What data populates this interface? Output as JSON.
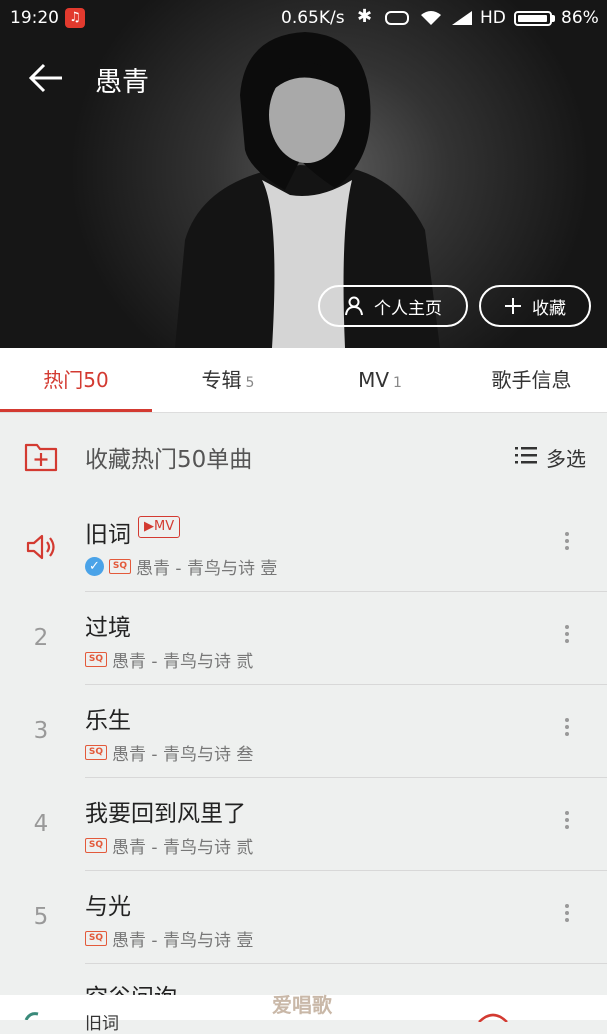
{
  "status_bar": {
    "time": "19:20",
    "app_icon": "netease-music-icon",
    "net_speed": "0.65K/s",
    "hd": "HD",
    "battery": "86%"
  },
  "header": {
    "artist_name": "愚青",
    "profile_button": "个人主页",
    "favorite_button": "收藏"
  },
  "tabs": [
    {
      "label": "热门50",
      "count": ""
    },
    {
      "label": "专辑",
      "count": "5"
    },
    {
      "label": "MV",
      "count": "1"
    },
    {
      "label": "歌手信息",
      "count": ""
    }
  ],
  "collect_bar": {
    "label": "收藏热门50单曲",
    "multi_select": "多选"
  },
  "songs": [
    {
      "num": "",
      "title": "旧词",
      "mv": "MV",
      "quality": "SQ",
      "meta": "愚青 - 青鸟与诗 壹",
      "playing": true
    },
    {
      "num": "2",
      "title": "过境",
      "quality": "SQ",
      "meta": "愚青 - 青鸟与诗 贰"
    },
    {
      "num": "3",
      "title": "乐生",
      "quality": "SQ",
      "meta": "愚青 - 青鸟与诗 叁"
    },
    {
      "num": "4",
      "title": "我要回到风里了",
      "quality": "SQ",
      "meta": "愚青 - 青鸟与诗 贰"
    },
    {
      "num": "5",
      "title": "与光",
      "quality": "SQ",
      "meta": "愚青 - 青鸟与诗 壹"
    }
  ],
  "partial_song_title": "空谷问询",
  "mini_player_title": "旧词",
  "watermark": "爱唱歌",
  "colors": {
    "accent": "#d33a31",
    "quality_badge": "#e35a3b",
    "verified": "#4aa3e8"
  }
}
